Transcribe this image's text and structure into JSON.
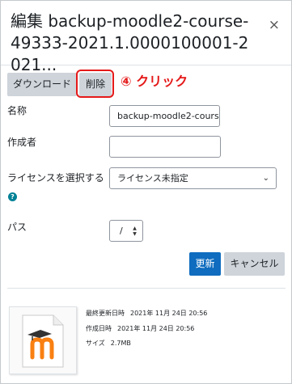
{
  "dialog": {
    "title": "編集 backup-moodle2-course-49333-2021.1.0000100001-2021...",
    "close_symbol": "×"
  },
  "toolbar": {
    "download_label": "ダウンロード",
    "delete_label": "削除"
  },
  "annotation": {
    "text": "④ クリック",
    "color": "#e51919"
  },
  "form": {
    "name_label": "名称",
    "name_value": "backup-moodle2-cours",
    "author_label": "作成者",
    "author_value": "",
    "license_label": "ライセンスを選択する",
    "license_value": "ライセンス未指定",
    "path_label": "パス",
    "path_value": "/",
    "help_symbol": "?"
  },
  "actions": {
    "update_label": "更新",
    "cancel_label": "キャンセル"
  },
  "fileinfo": {
    "modified_label": "最終更新日時",
    "modified_value": "2021年 11月 24日 20:56",
    "created_label": "作成日時",
    "created_value": "2021年 11月 24日 20:56",
    "size_label": "サイズ",
    "size_value": "2.7MB"
  },
  "colors": {
    "primary": "#0f6cbf",
    "secondary": "#ced4da",
    "help": "#008196",
    "moodle_orange": "#f98012"
  }
}
